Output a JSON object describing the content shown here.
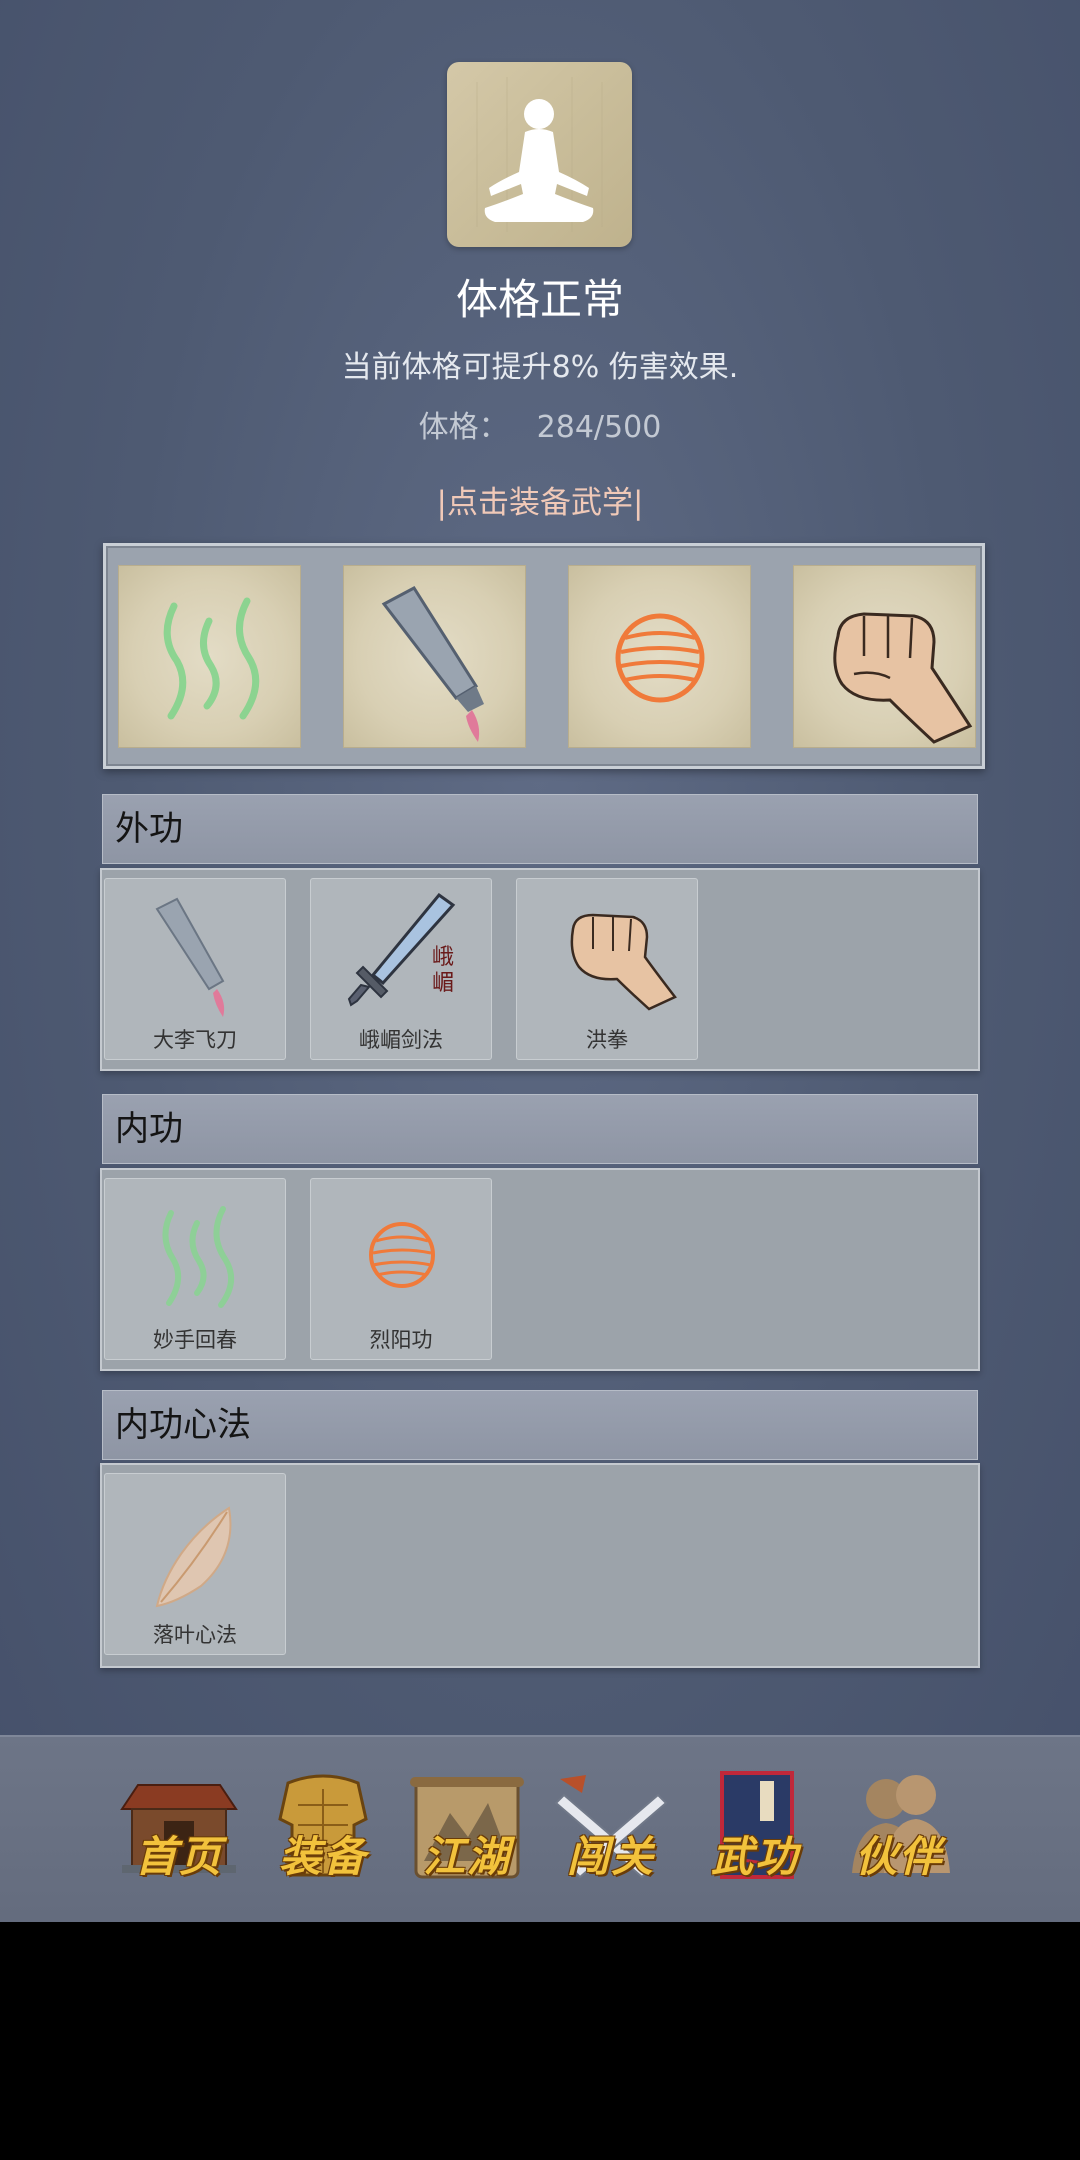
{
  "status": {
    "title": "体格正常",
    "description": "当前体格可提升8% 伤害效果.",
    "physique_label": "体格：",
    "physique_value": "284/500"
  },
  "equip_hint": "|点击装备武学|",
  "equipped_slots": [
    {
      "icon": "green-qi-icon"
    },
    {
      "icon": "flying-knife-icon"
    },
    {
      "icon": "sun-orb-icon"
    },
    {
      "icon": "fist-icon"
    }
  ],
  "sections": {
    "external": {
      "title": "外功",
      "skills": [
        {
          "name": "大李飞刀",
          "icon": "flying-knife-icon"
        },
        {
          "name": "峨嵋剑法",
          "icon": "sword-icon",
          "mark": "峨\n嵋"
        },
        {
          "name": "洪拳",
          "icon": "fist-icon"
        }
      ]
    },
    "internal": {
      "title": "内功",
      "skills": [
        {
          "name": "妙手回春",
          "icon": "green-qi-icon"
        },
        {
          "name": "烈阳功",
          "icon": "sun-orb-icon"
        }
      ]
    },
    "mind": {
      "title": "内功心法",
      "skills": [
        {
          "name": "落叶心法",
          "icon": "leaf-icon"
        }
      ]
    }
  },
  "nav": [
    {
      "label": "首页",
      "icon": "house-icon"
    },
    {
      "label": "装备",
      "icon": "armor-icon"
    },
    {
      "label": "江湖",
      "icon": "scroll-map-icon"
    },
    {
      "label": "闯关",
      "icon": "crossed-swords-icon"
    },
    {
      "label": "武功",
      "icon": "manual-book-icon",
      "active": true
    },
    {
      "label": "伙伴",
      "icon": "companions-icon"
    }
  ],
  "colors": {
    "background": "#535f78",
    "hint": "#f0c9b8",
    "nav_label": "#f2c23c"
  }
}
